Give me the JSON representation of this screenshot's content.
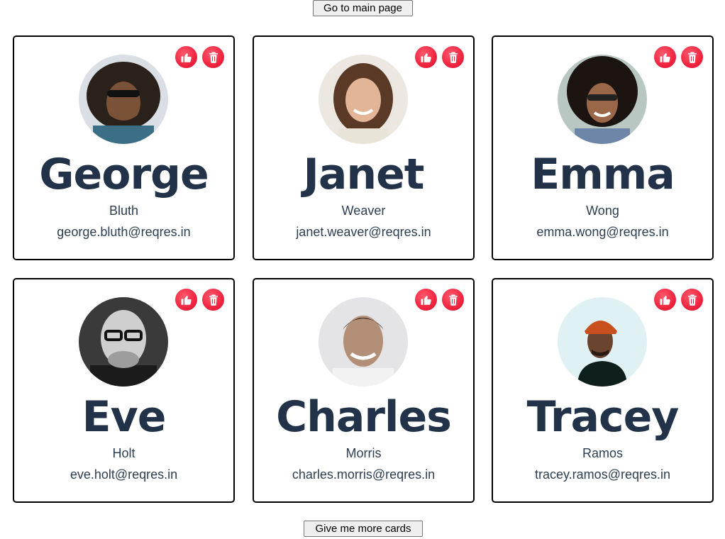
{
  "nav": {
    "top_button": "Go to main page",
    "bottom_button": "Give me more cards"
  },
  "icons": {
    "like": "thumbs-up-icon",
    "delete": "trash-icon"
  },
  "colors": {
    "action_red": "#f0243f",
    "name_navy": "#213249",
    "card_border": "#000000"
  },
  "cards": [
    {
      "first_name": "George",
      "last_name": "Bluth",
      "email": "george.bluth@reqres.in"
    },
    {
      "first_name": "Janet",
      "last_name": "Weaver",
      "email": "janet.weaver@reqres.in"
    },
    {
      "first_name": "Emma",
      "last_name": "Wong",
      "email": "emma.wong@reqres.in"
    },
    {
      "first_name": "Eve",
      "last_name": "Holt",
      "email": "eve.holt@reqres.in"
    },
    {
      "first_name": "Charles",
      "last_name": "Morris",
      "email": "charles.morris@reqres.in"
    },
    {
      "first_name": "Tracey",
      "last_name": "Ramos",
      "email": "tracey.ramos@reqres.in"
    }
  ]
}
